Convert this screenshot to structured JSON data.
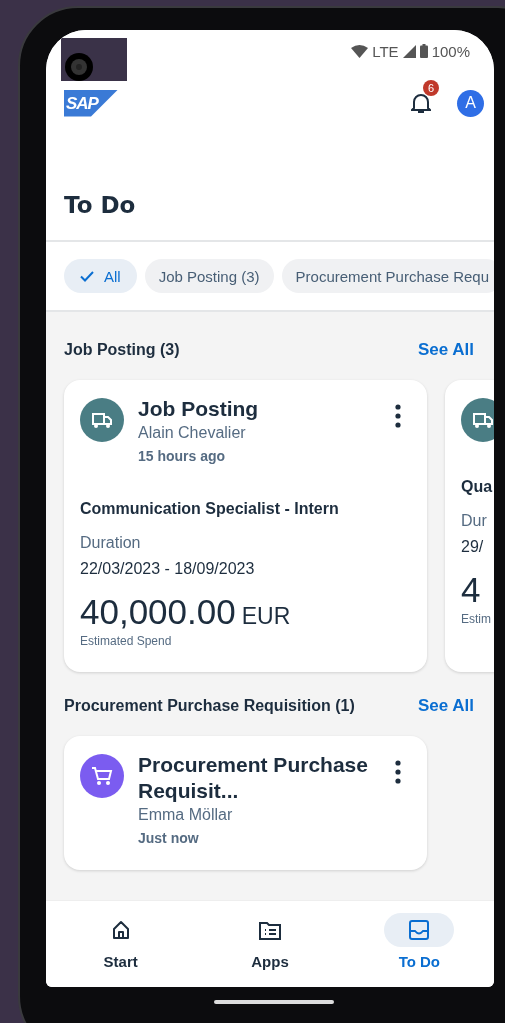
{
  "status_bar": {
    "network": "LTE",
    "battery": "100%"
  },
  "header": {
    "logo": "SAP",
    "notification_count": "6",
    "avatar_initial": "A"
  },
  "title": "To Do",
  "filters": [
    {
      "label": "All",
      "selected": true
    },
    {
      "label": "Job Posting (3)",
      "selected": false
    },
    {
      "label": "Procurement Purchase Requ",
      "selected": false
    }
  ],
  "sections": [
    {
      "title": "Job Posting (3)",
      "action": "See All",
      "cards": [
        {
          "kind": "truck",
          "color": "#4a7d84",
          "title": "Job Posting",
          "author": "Alain Chevalier",
          "time": "15 hours ago",
          "subtitle": "Communication Specialist - Intern",
          "field_label": "Duration",
          "field_value": "22/03/2023 - 18/09/2023",
          "amount": "40,000.00",
          "currency": "EUR",
          "amount_label": "Estimated Spend"
        },
        {
          "kind": "truck",
          "color": "#4a7d84",
          "subtitle": "Qua",
          "field_label": "Dur",
          "field_value": "29/",
          "amount": "4",
          "amount_label": "Estim"
        }
      ]
    },
    {
      "title": "Procurement Purchase Requisition (1)",
      "action": "See All",
      "cards": [
        {
          "kind": "cart",
          "color": "#7b5cf0",
          "title": "Procurement Purchase Requisit...",
          "author": "Emma Möllar",
          "time": "Just now"
        }
      ]
    }
  ],
  "nav": [
    {
      "kind": "home",
      "label": "Start",
      "selected": false
    },
    {
      "kind": "apps",
      "label": "Apps",
      "selected": false
    },
    {
      "kind": "inbox",
      "label": "To Do",
      "selected": true
    }
  ]
}
